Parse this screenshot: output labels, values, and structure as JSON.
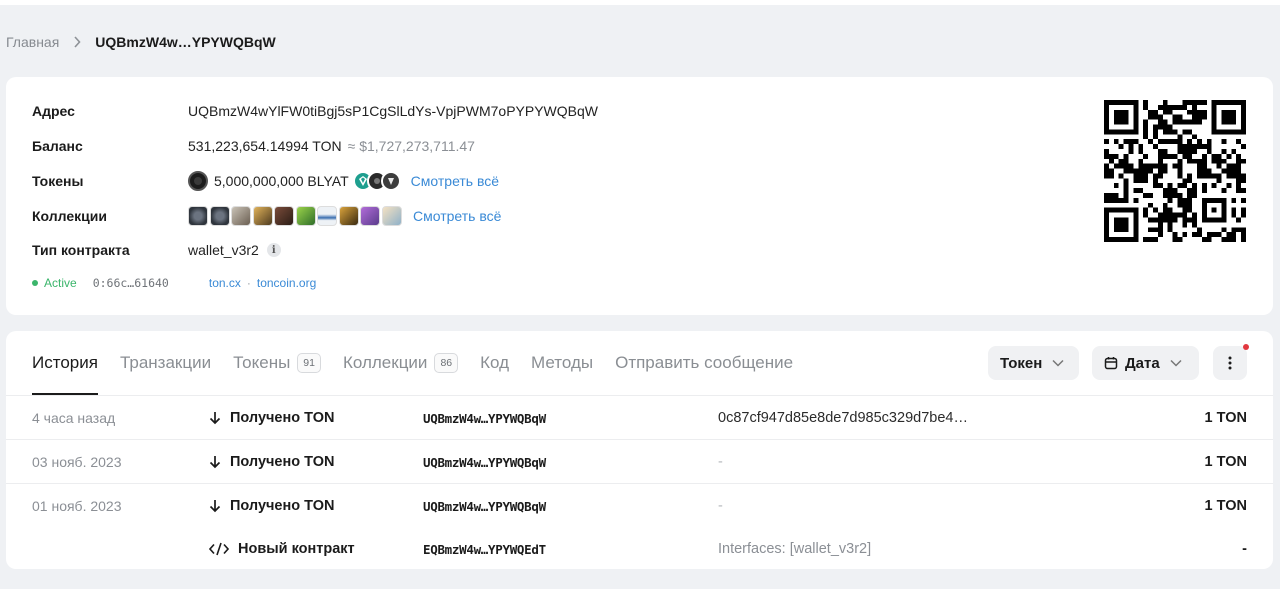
{
  "breadcrumb": {
    "home": "Главная",
    "current": "UQBmzW4w…YPYWQBqW"
  },
  "info": {
    "address_label": "Адрес",
    "address": "UQBmzW4wYlFW0tiBgj5sP1CgSlLdYs-VpjPWM7oPYPYWQBqW",
    "balance_label": "Баланс",
    "balance": "531,223,654.14994 TON",
    "balance_fiat": "≈ $1,727,273,711.47",
    "tokens_label": "Токены",
    "token_main": "5,000,000,000 BLYAT",
    "tokens_see_all": "Смотреть всё",
    "collections_label": "Коллекции",
    "collections_see_all": "Смотреть всё",
    "contract_label": "Тип контракта",
    "contract_type": "wallet_v3r2",
    "info_icon": "i",
    "status": "Active",
    "hash": "0:66c…61640",
    "link1": "ton.cx",
    "link_sep": "·",
    "link2": "toncoin.org"
  },
  "tabs": [
    {
      "label": "История",
      "count": null
    },
    {
      "label": "Транзакции",
      "count": null
    },
    {
      "label": "Токены",
      "count": "91"
    },
    {
      "label": "Коллекции",
      "count": "86"
    },
    {
      "label": "Код",
      "count": null
    },
    {
      "label": "Методы",
      "count": null
    },
    {
      "label": "Отправить сообщение",
      "count": null
    }
  ],
  "filters": {
    "token": "Токен",
    "date": "Дата"
  },
  "transactions": [
    {
      "time": "4 часа назад",
      "type": "Получено TON",
      "address": "UQBmzW4w…YPYWQBqW",
      "comment": "0c87cf947d85e8de7d985c329d7be4…",
      "amount": "1 TON"
    },
    {
      "time": "03 нояб. 2023",
      "type": "Получено TON",
      "address": "UQBmzW4w…YPYWQBqW",
      "comment": "-",
      "amount": "1 TON"
    },
    {
      "time": "01 нояб. 2023",
      "type": "Получено TON",
      "address": "UQBmzW4w…YPYWQBqW",
      "comment": "-",
      "amount": "1 TON"
    },
    {
      "time": "",
      "type": "Новый контракт",
      "address": "EQBmzW4w…YPYWQEdT",
      "comment": "Interfaces: [wallet_v3r2]",
      "amount": "-"
    }
  ],
  "colors": {
    "accent_link": "#3a8ad6",
    "status_active": "#3bb56b",
    "notification": "#e2373f"
  }
}
